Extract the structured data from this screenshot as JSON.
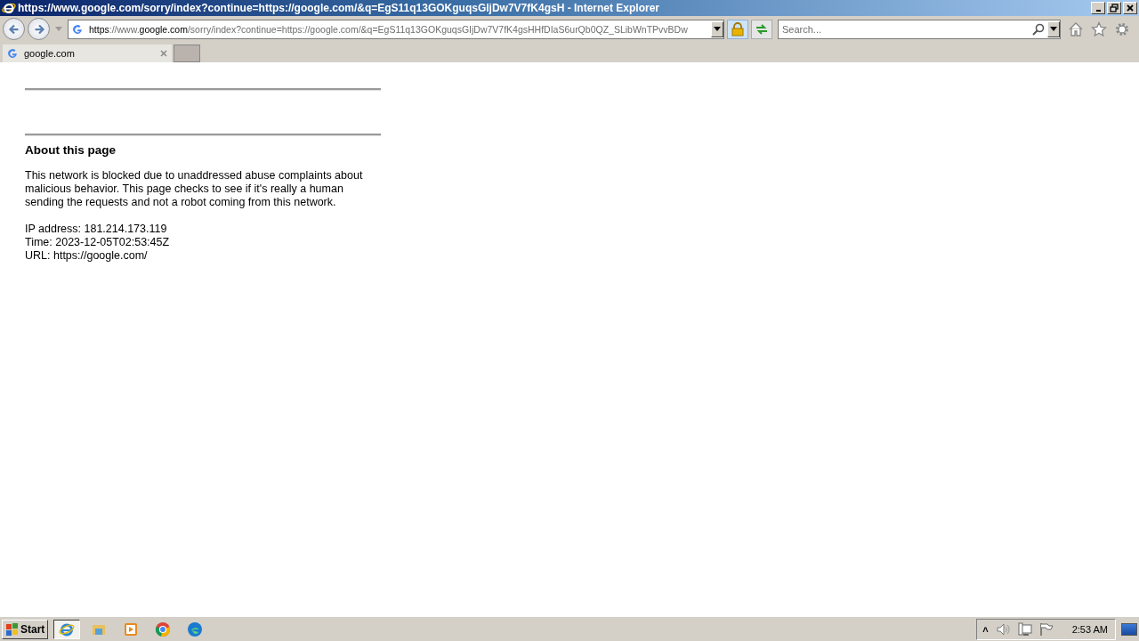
{
  "window": {
    "title": "https://www.google.com/sorry/index?continue=https://google.com/&q=EgS11q13GOKguqsGIjDw7V7fK4gsH - Internet Explorer"
  },
  "address_bar": {
    "segments": [
      {
        "text": "https",
        "emphasis": true
      },
      {
        "text": "://www.",
        "emphasis": false
      },
      {
        "text": "google.com",
        "emphasis": true
      },
      {
        "text": "/sorry/index?continue=https://google.com/&q=EgS11q13GOKguqsGIjDw7V7fK4gsHHfDIaS6urQb0QZ_SLibWnTPvvBDw",
        "emphasis": false
      }
    ]
  },
  "search": {
    "placeholder": "Search..."
  },
  "tabs": [
    {
      "label": "google.com",
      "selected": true
    }
  ],
  "page": {
    "heading": "About this page",
    "paragraph": "This network is blocked due to unaddressed abuse complaints about malicious behavior. This page checks to see if it's really a human sending the requests and not a robot coming from this network.",
    "details": [
      "IP address: 181.214.173.119",
      "Time: 2023-12-05T02:53:45Z",
      "URL: https://google.com/"
    ]
  },
  "taskbar": {
    "start": "Start",
    "apps": [
      {
        "kind": "ie",
        "selected": true
      },
      {
        "kind": "folder",
        "selected": false
      },
      {
        "kind": "media",
        "selected": false
      },
      {
        "kind": "chrome",
        "selected": false
      },
      {
        "kind": "edge",
        "selected": false
      }
    ],
    "tray": {
      "expand": "˄",
      "time": "2:53 AM"
    }
  }
}
